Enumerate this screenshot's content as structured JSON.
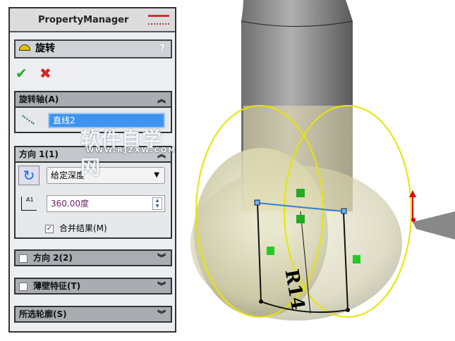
{
  "panel": {
    "title": "PropertyManager",
    "feature": "旋转",
    "help": "?"
  },
  "axis_section": {
    "title": "旋转轴(A)",
    "value": "直线2"
  },
  "dir1": {
    "title": "方向 1(1)",
    "end_condition": "给定深度",
    "angle": "360.00度",
    "merge_label": "合并结果(M)",
    "merge_checked": true
  },
  "dir2": {
    "title": "方向 2(2)",
    "checked": false
  },
  "thin": {
    "title": "薄壁特征(T)",
    "checked": false
  },
  "contours": {
    "title": "所选轮廓(S)"
  },
  "viewport": {
    "dimension": "R14"
  },
  "watermark": {
    "main": "软件自学网",
    "url": "WWW.RJZXW.COM"
  }
}
